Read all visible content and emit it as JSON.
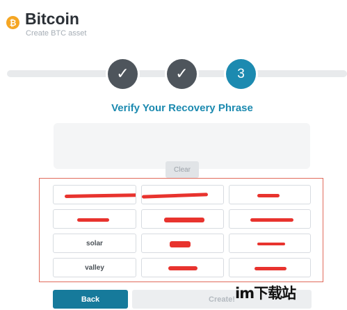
{
  "header": {
    "coin_symbol": "₿",
    "title": "Bitcoin",
    "subtitle": "Create BTC asset"
  },
  "steps": [
    {
      "label": "✓",
      "state": "done"
    },
    {
      "label": "✓",
      "state": "done"
    },
    {
      "label": "3",
      "state": "active"
    }
  ],
  "heading": "Verify Your Recovery Phrase",
  "clear_label": "Clear",
  "words": [
    "",
    "",
    "",
    "",
    "",
    "",
    "solar",
    "",
    "",
    "valley",
    "",
    ""
  ],
  "back_label": "Back",
  "create_label": "Create!",
  "watermark": "im下载站",
  "colors": {
    "accent": "#1c8ab0",
    "step_done": "#4e555c",
    "redaction": "#e8332e",
    "highlight_border": "#e06a5a",
    "coin": "#f5a623"
  }
}
